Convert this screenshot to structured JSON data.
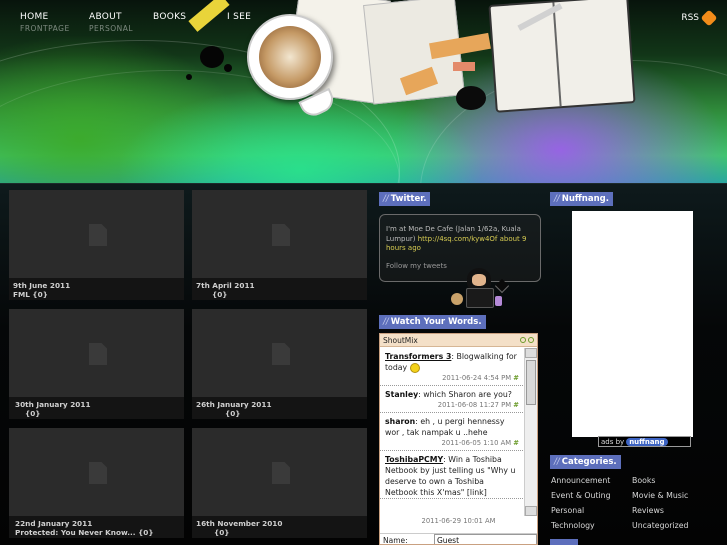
{
  "nav": [
    {
      "label": "HOME",
      "sub": "FRONTPAGE"
    },
    {
      "label": "ABOUT",
      "sub": "PERSONAL"
    },
    {
      "label": "BOOKS",
      "sub": ""
    },
    {
      "label": "I SEE",
      "sub": ""
    }
  ],
  "rss": {
    "label": "RSS",
    "icon": "rss-heart-icon"
  },
  "posts": [
    {
      "date": "9th June 2011",
      "title": "FML {0}"
    },
    {
      "date": "7th April 2011",
      "title": "{0}"
    },
    {
      "date": "30th January 2011",
      "title": "{0}"
    },
    {
      "date": "26th January 2011",
      "title": "{0}"
    },
    {
      "date": "22nd January 2011",
      "title": "Protected: You Never Know... {0}"
    },
    {
      "date": "16th November 2010",
      "title": "{0}"
    }
  ],
  "twitter": {
    "title": "Twitter.",
    "tweet_text": "I'm at Moe De Cafe (Jalan 1/62a, Kuala Lumpur) ",
    "tweet_link": "http://4sq.com/kyw4Of about 9 hours ago",
    "follow": "Follow my tweets"
  },
  "watch": {
    "title": "Watch Your Words."
  },
  "shoutmix": {
    "header": "ShoutMix",
    "messages": [
      {
        "name": "Transformers 3",
        "text": ": Blogwalking for today",
        "time": "2011-06-24 4:54 PM",
        "underline": true,
        "smiley": true
      },
      {
        "name": "Stanley",
        "text": ": which Sharon are you?",
        "time": "2011-06-08 11:27 PM",
        "underline": false,
        "smiley": false
      },
      {
        "name": "sharon",
        "text": ": eh , u pergi hennessy wor , tak nampak u ..hehe",
        "time": "2011-06-05 1:10 AM",
        "underline": false,
        "smiley": false
      },
      {
        "name": "ToshibaPCMY",
        "text": ": Win a Toshiba Netbook by just telling us \"Why u deserve to own a Toshiba Netbook this X'mas\" [link]",
        "time": "",
        "underline": true,
        "smiley": false
      }
    ],
    "last_time": "2011-06-29 10:01 AM",
    "hash": "#",
    "name_label": "Name:",
    "name_value": "Guest"
  },
  "nuffnang": {
    "title": "Nuffnang.",
    "credit_prefix": "ads by",
    "brand": "nuffnang"
  },
  "categories": {
    "title": "Categories.",
    "items": [
      "Announcement",
      "Books",
      "Event & Outing",
      "Movie & Music",
      "Personal",
      "Reviews",
      "Technology",
      "Uncategorized"
    ]
  },
  "colors": {
    "accent": "#5d6fbc",
    "link": "#d7cc52",
    "rss": "#f28c1a"
  }
}
